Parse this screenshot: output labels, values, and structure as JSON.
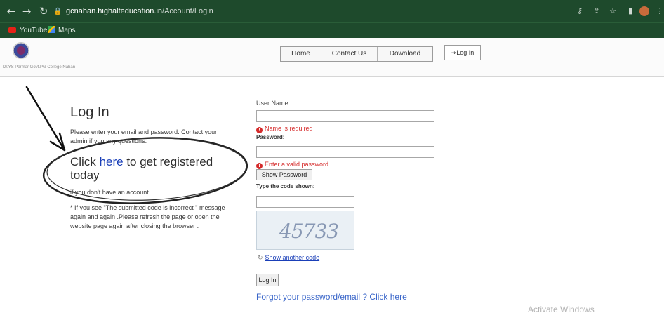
{
  "browser": {
    "url_host": "gcnahan.highalteducation.in",
    "url_path": "/Account/Login",
    "bookmarks": [
      {
        "label": "YouTube"
      },
      {
        "label": "Maps"
      }
    ]
  },
  "site": {
    "college_name": "Dr.YS Parmar Govt.PG College Nahan",
    "nav": [
      "Home",
      "Contact Us",
      "Download"
    ],
    "login_button": "Log In"
  },
  "left": {
    "title": "Log In",
    "intro_line1": "Please enter your email and password. Contact your",
    "intro_line2": "admin if you any questions.",
    "register_prefix": "Click ",
    "register_link": "here",
    "register_suffix": " to get registered today",
    "no_account": "if you don't have an account.",
    "note_line1": "* If you see \"The submitted code is incorrect \" message",
    "note_line2": "again and again .Please refresh the page or open the",
    "note_line3": "website page again after closing the browser ."
  },
  "form": {
    "username_label": "User Name:",
    "username_value": "",
    "username_error": "Name is required",
    "password_label": "Password:",
    "password_value": "",
    "password_error": "Enter a valid password",
    "show_password": "Show Password",
    "code_label": "Type the code shown:",
    "code_value": "",
    "captcha_text": "45733",
    "show_another": "Show another code",
    "submit": "Log In",
    "forgot": "Forgot your password/email ? Click here"
  },
  "watermark": "Activate Windows",
  "colors": {
    "chrome": "#1e4a2c",
    "link": "#1a3fb8",
    "error": "#d52b2b"
  }
}
